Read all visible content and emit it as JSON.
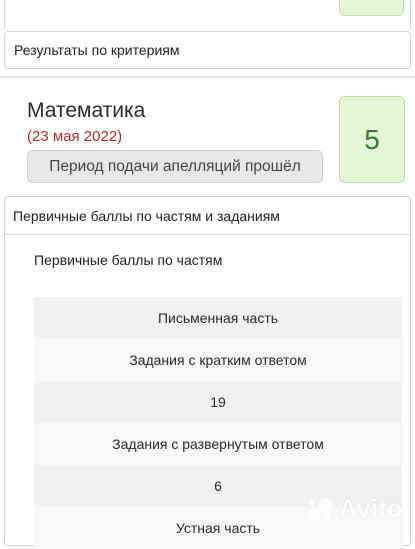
{
  "criteria": {
    "label": "Результаты по критериям"
  },
  "exam": {
    "subject": "Математика",
    "date": "(23 мая 2022)",
    "appeal_status": "Период подачи апелляций прошёл",
    "grade": "5"
  },
  "parts": {
    "header": "Первичные баллы по частям и заданиям",
    "subtitle": "Первичные баллы по частям",
    "rows": [
      "Письменная часть",
      "Задания с кратким ответом",
      "19",
      "Задания с развернутым ответом",
      "6",
      "Устная часть"
    ]
  },
  "watermark": {
    "text": "Avito",
    "icon": "avito-logo-icon"
  },
  "colors": {
    "grade_bg": "#e2f6d8",
    "grade_text": "#3c7a2a",
    "date_text": "#b3312a"
  }
}
